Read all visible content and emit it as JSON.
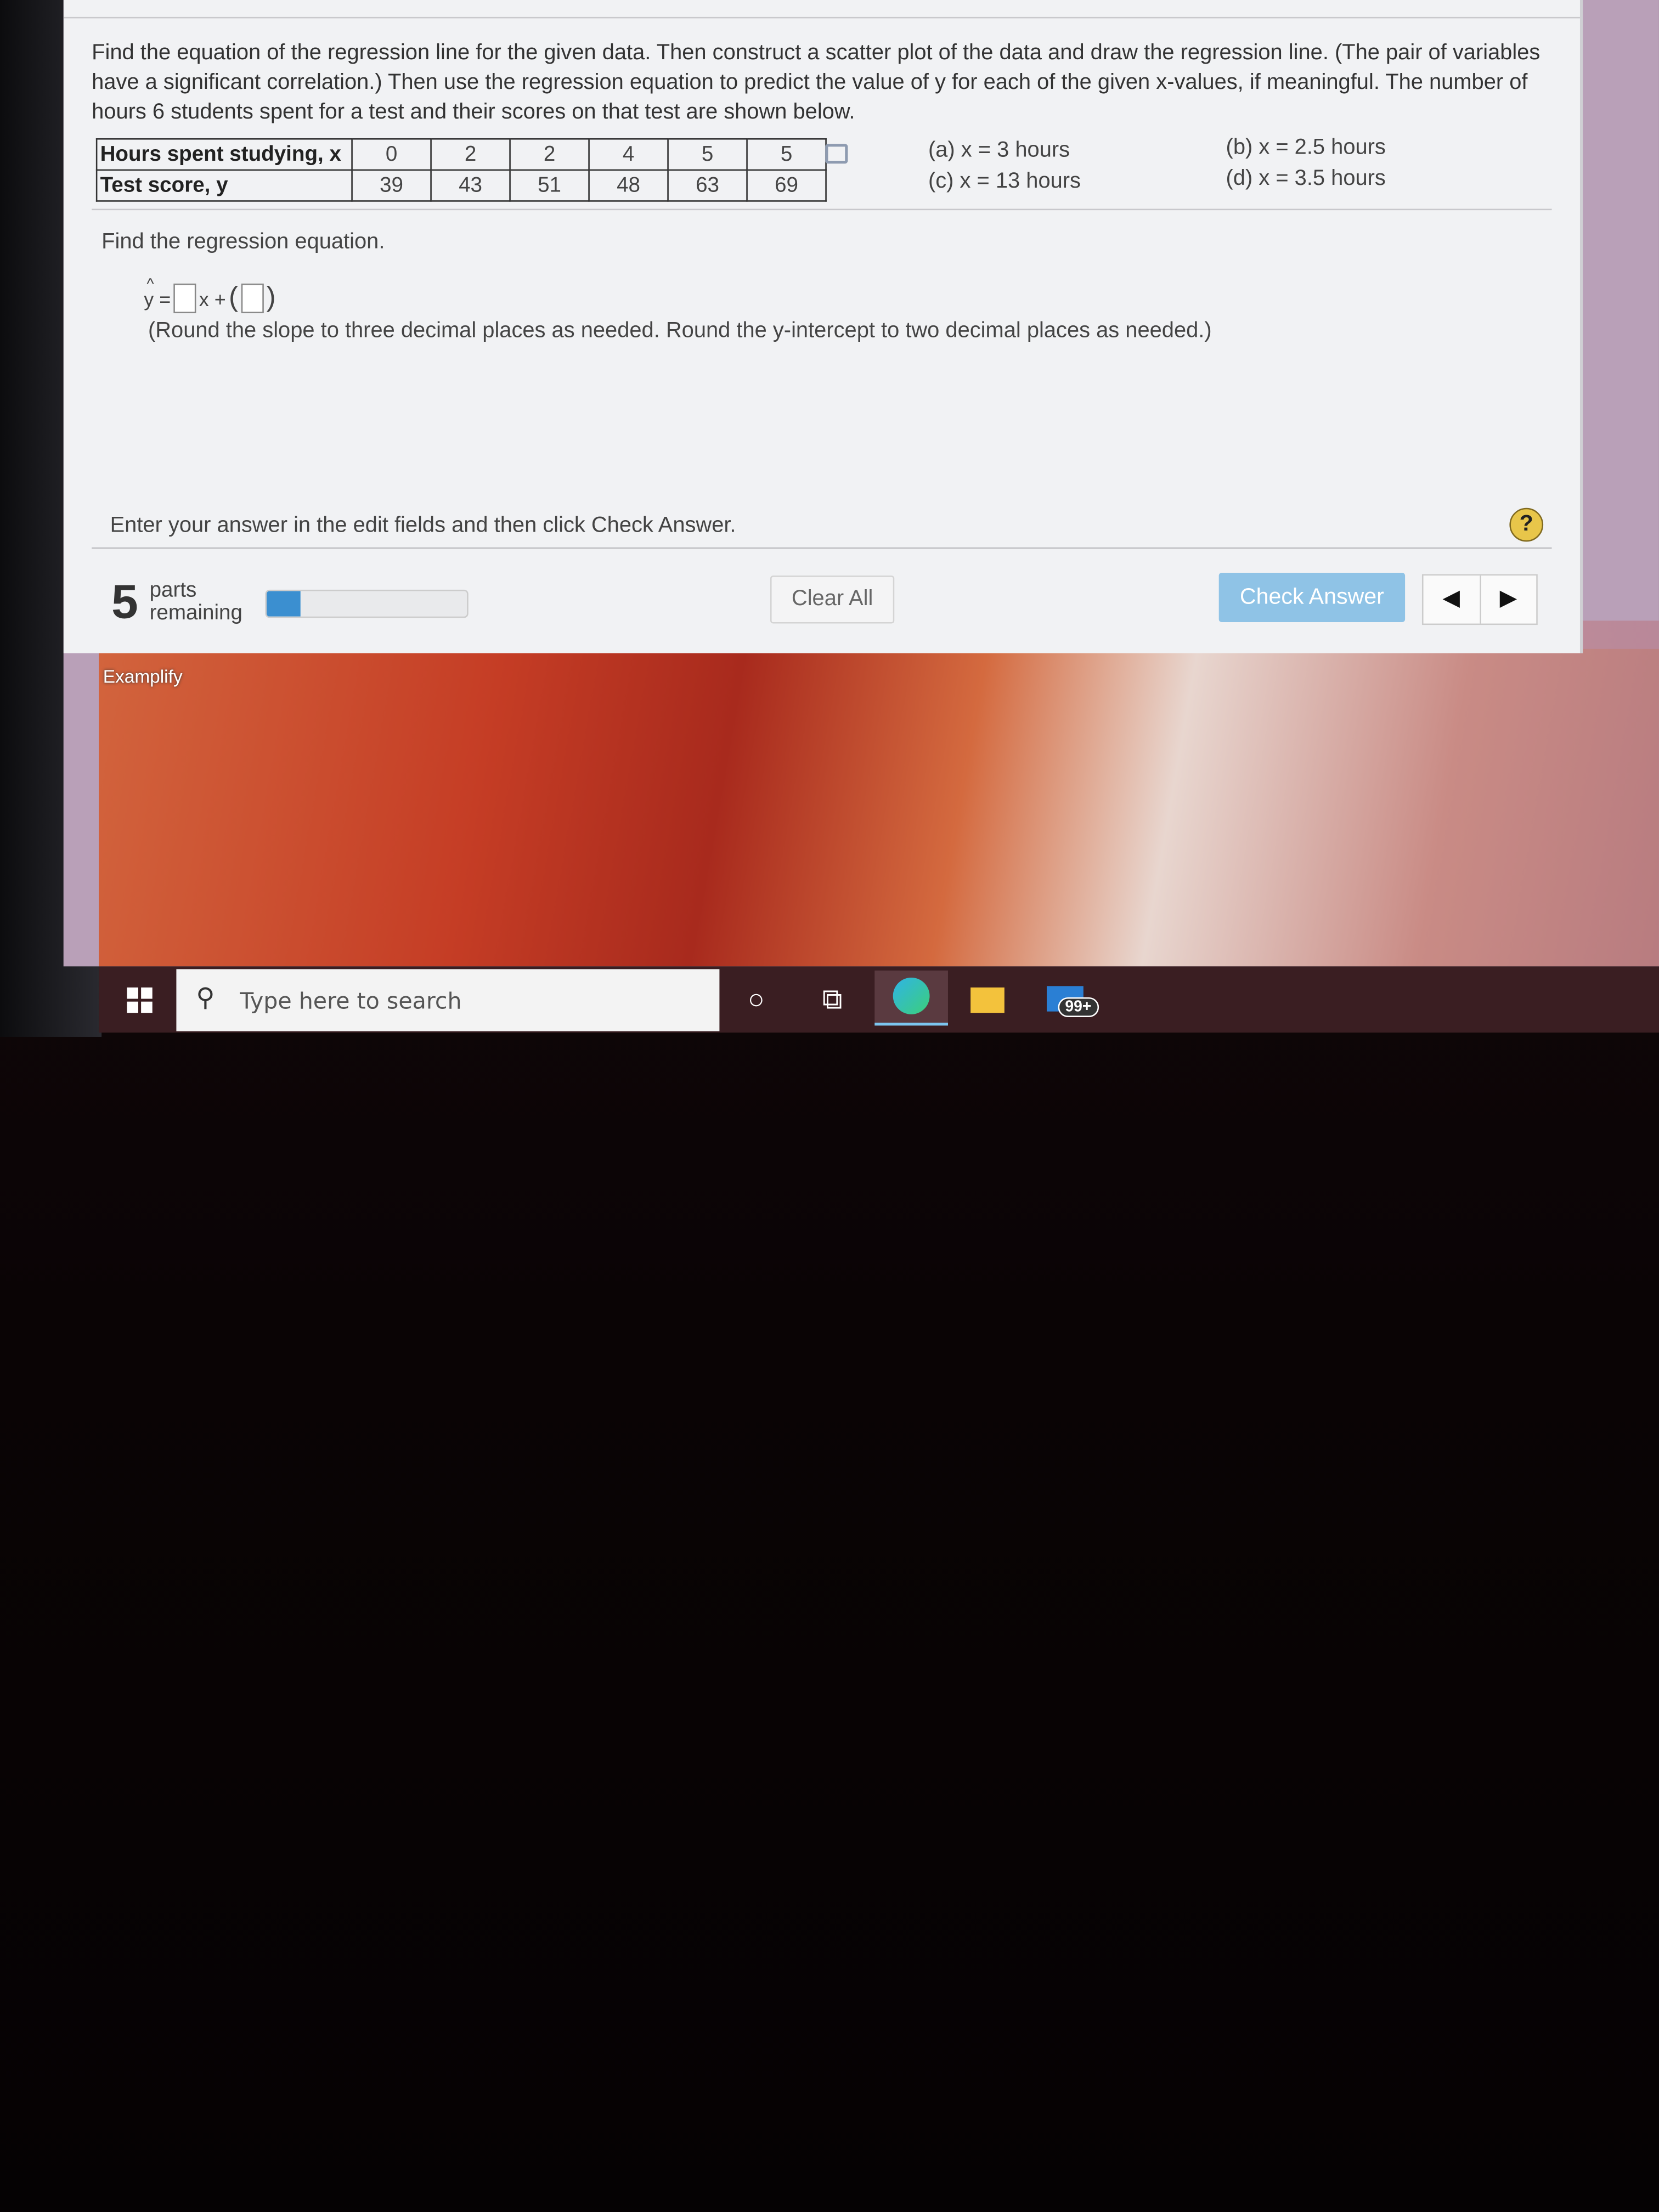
{
  "question": {
    "text": "Find the equation of the regression line for the given data. Then construct a scatter plot of the data and draw the regression line. (The pair of variables have a significant correlation.) Then use the regression equation to predict the value of y for each of the given x-values, if meaningful. The number of hours 6 students spent for a test and their scores on that test are shown below.",
    "table": {
      "row_x_label": "Hours spent studying, x",
      "row_y_label": "Test score, y",
      "x": [
        "0",
        "2",
        "2",
        "4",
        "5",
        "5"
      ],
      "y": [
        "39",
        "43",
        "51",
        "48",
        "63",
        "69"
      ]
    },
    "parts": [
      "(a) x = 3 hours",
      "(b) x = 2.5 hours",
      "(c) x = 13 hours",
      "(d) x = 3.5 hours"
    ]
  },
  "answer": {
    "prompt": "Find the regression equation.",
    "eq_lhs": "y =",
    "eq_mid": "x +",
    "hint": "(Round the slope to three decimal places as needed. Round the y-intercept to two decimal places as needed.)"
  },
  "footer": {
    "instruction": "Enter your answer in the edit fields and then click Check Answer.",
    "help": "?",
    "parts_count": "5",
    "parts_label_1": "parts",
    "parts_label_2": "remaining",
    "progress_fraction": 0.17,
    "clear_all": "Clear All",
    "check_answer": "Check Answer",
    "prev": "◀",
    "next": "▶"
  },
  "desktop": {
    "shortcut": "Examplify"
  },
  "taskbar": {
    "search_placeholder": "Type here to search",
    "mail_badge": "99+",
    "accent": "#7cc6f0"
  }
}
